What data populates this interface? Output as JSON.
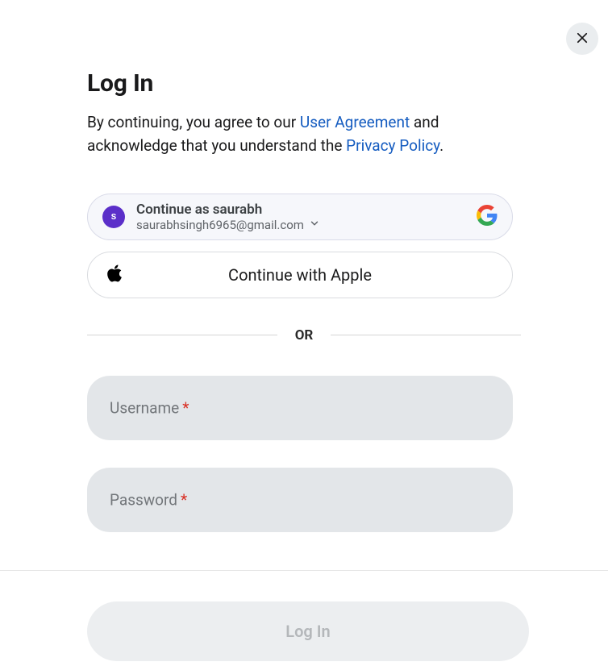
{
  "title": "Log In",
  "subtitle": {
    "prefix": "By continuing, you agree to our ",
    "link1": "User Agreement",
    "mid": " and acknowledge that you understand the ",
    "link2": "Privacy Policy",
    "suffix": "."
  },
  "google": {
    "avatar_initial": "s",
    "primary": "Continue as saurabh",
    "secondary": "saurabhsingh6965@gmail.com"
  },
  "apple": {
    "label": "Continue with Apple"
  },
  "divider": "OR",
  "username": {
    "label": "Username",
    "required": "*"
  },
  "password": {
    "label": "Password",
    "required": "*"
  },
  "submit": "Log In"
}
